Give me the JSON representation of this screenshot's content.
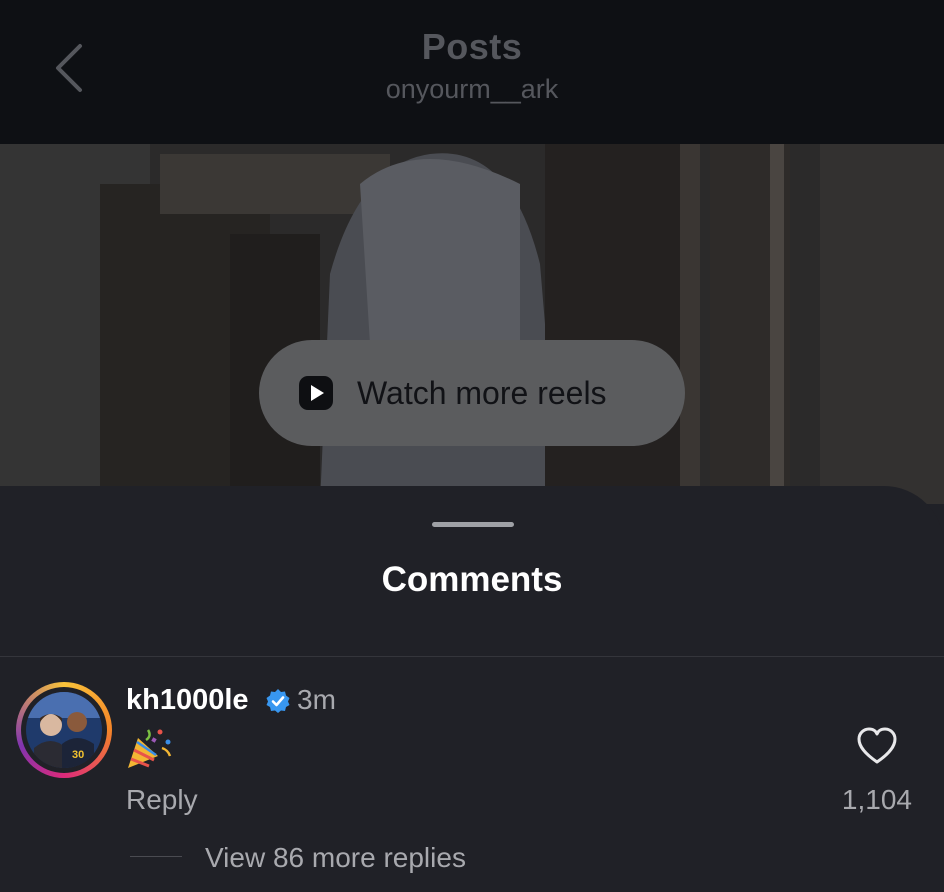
{
  "header": {
    "title": "Posts",
    "subtitle": "onyourm__ark",
    "back_icon": "chevron-left-icon"
  },
  "video": {
    "watch_more_label": "Watch more reels",
    "play_icon": "play-icon"
  },
  "comments": {
    "title": "Comments",
    "items": [
      {
        "username": "kh1000le",
        "verified": true,
        "time": "3m",
        "text_emoji": "party-popper-icon",
        "reply_label": "Reply",
        "like_count": "1,104",
        "view_replies_label": "View 86 more replies"
      }
    ]
  },
  "colors": {
    "header_bg": "#0e1014",
    "sheet_bg": "#202127",
    "muted_text": "#a8a9ae",
    "verified_blue": "#3897f0"
  }
}
